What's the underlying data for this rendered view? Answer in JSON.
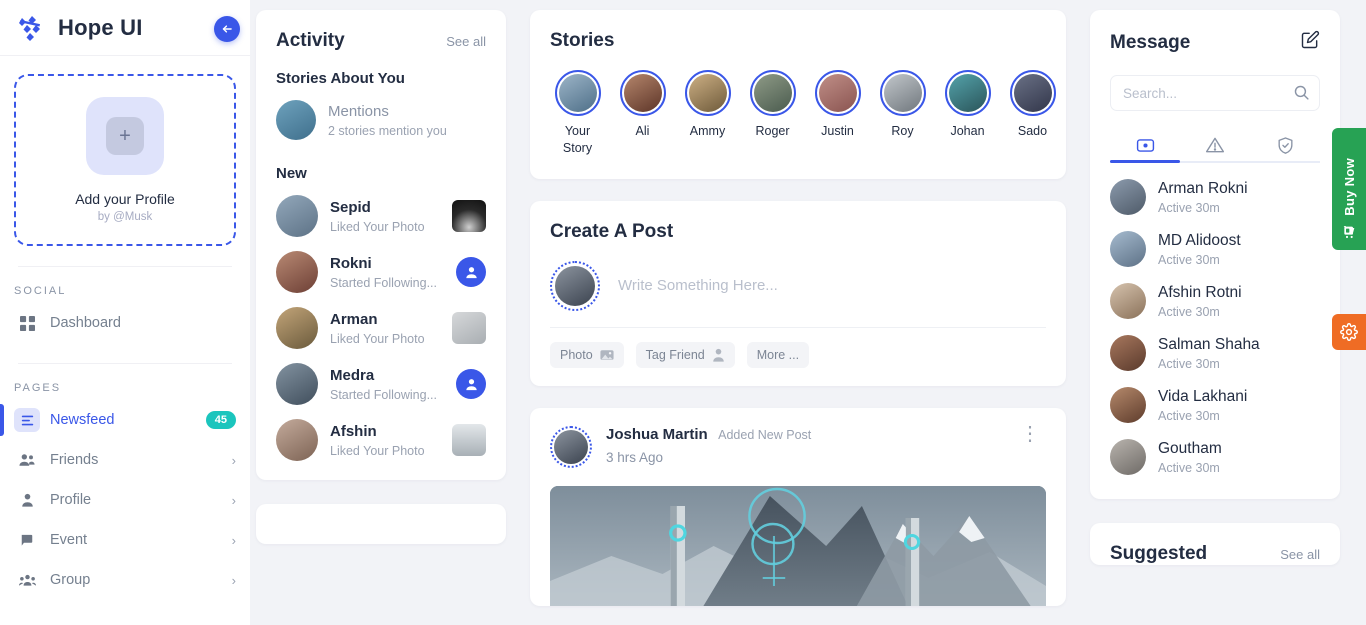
{
  "brand": {
    "title": "Hope UI",
    "logo_icon": "hope-ui-logo"
  },
  "sidebar": {
    "collapse_icon": "arrow-left-icon",
    "profile_card": {
      "plus_icon": "plus-icon",
      "title": "Add your Profile",
      "subtitle": "by @Musk"
    },
    "sections": [
      {
        "label": "SOCIAL",
        "items": [
          {
            "label": "Dashboard",
            "icon": "grid-icon",
            "active": false,
            "badge": null,
            "chevron": false
          }
        ]
      },
      {
        "label": "PAGES",
        "items": [
          {
            "label": "Newsfeed",
            "icon": "feed-icon",
            "active": true,
            "badge": "45",
            "chevron": false
          },
          {
            "label": "Friends",
            "icon": "friends-icon",
            "active": false,
            "badge": null,
            "chevron": true
          },
          {
            "label": "Profile",
            "icon": "person-icon",
            "active": false,
            "badge": null,
            "chevron": true
          },
          {
            "label": "Event",
            "icon": "event-flag-icon",
            "active": false,
            "badge": null,
            "chevron": true
          },
          {
            "label": "Group",
            "icon": "group-icon",
            "active": false,
            "badge": null,
            "chevron": true
          }
        ]
      }
    ]
  },
  "activity": {
    "title": "Activity",
    "see_all": "See all",
    "stories_about_you_heading": "Stories About You",
    "mentions": {
      "name": "Mentions",
      "sub": "2 stories mention you",
      "avatar_color": "#5c8fb0"
    },
    "new_heading": "New",
    "items": [
      {
        "name": "Sepid",
        "sub": "Liked Your Photo",
        "trailing": "thumb",
        "avatar_color": "#7c93a8",
        "thumb_color": "#2a2a2a"
      },
      {
        "name": "Rokni",
        "sub": "Started Following...",
        "trailing": "follow",
        "avatar_color": "#8d5c4e",
        "thumb_color": ""
      },
      {
        "name": "Arman",
        "sub": "Liked Your Photo",
        "trailing": "thumb",
        "avatar_color": "#9c8260",
        "thumb_color": "#b9bcbe"
      },
      {
        "name": "Medra",
        "sub": "Started Following...",
        "trailing": "follow",
        "avatar_color": "#5e6c7a",
        "thumb_color": ""
      },
      {
        "name": "Afshin",
        "sub": "Liked Your Photo",
        "trailing": "thumb",
        "avatar_color": "#a08b7d",
        "thumb_color": "#c2c8cc"
      }
    ],
    "follow_icon": "add-person-icon"
  },
  "stories": {
    "title": "Stories",
    "items": [
      {
        "name": "Your Story",
        "avatar_color": "#6d8aa5"
      },
      {
        "name": "Ali",
        "avatar_color": "#8a5f4c"
      },
      {
        "name": "Ammy",
        "avatar_color": "#a3875f"
      },
      {
        "name": "Roger",
        "avatar_color": "#6f7f6a"
      },
      {
        "name": "Justin",
        "avatar_color": "#b07d78"
      },
      {
        "name": "Roy",
        "avatar_color": "#98a0a6"
      },
      {
        "name": "Johan",
        "avatar_color": "#3f7f86"
      },
      {
        "name": "Sado",
        "avatar_color": "#4a4f63"
      }
    ]
  },
  "create_post": {
    "title": "Create A Post",
    "placeholder": "Write Something Here...",
    "avatar_color": "#4e5866",
    "actions": [
      {
        "label": "Photo",
        "icon": "photo-icon"
      },
      {
        "label": "Tag Friend",
        "icon": "person-icon"
      },
      {
        "label": "More ...",
        "icon": ""
      }
    ]
  },
  "feed_post": {
    "author": "Joshua Martin",
    "action": "Added New Post",
    "time": "3 hrs Ago",
    "menu_icon": "kebab-menu-icon",
    "avatar_color": "#4e5866"
  },
  "message": {
    "title": "Message",
    "compose_icon": "compose-edit-icon",
    "search_placeholder": "Search...",
    "search_value": "",
    "search_icon": "search-icon",
    "tabs": [
      {
        "icon": "chat-bubble-icon",
        "active": true
      },
      {
        "icon": "alert-triangle-icon",
        "active": false
      },
      {
        "icon": "shield-check-icon",
        "active": false
      }
    ],
    "contacts": [
      {
        "name": "Arman Rokni",
        "status": "Active 30m",
        "avatar_color": "#6b7a8c"
      },
      {
        "name": "MD Alidoost",
        "status": "Active 30m",
        "avatar_color": "#8296ad"
      },
      {
        "name": "Afshin Rotni",
        "status": "Active 30m",
        "avatar_color": "#b79d86"
      },
      {
        "name": "Salman Shaha",
        "status": "Active 30m",
        "avatar_color": "#8b6a55"
      },
      {
        "name": "Vida Lakhani",
        "status": "Active 30m",
        "avatar_color": "#9a7158"
      },
      {
        "name": "Goutham",
        "status": "Active 30m",
        "avatar_color": "#9b9791"
      }
    ]
  },
  "suggested": {
    "title": "Suggested",
    "see_all": "See all"
  },
  "floating": {
    "buy_now": {
      "label": "Buy Now",
      "icon": "cart-icon",
      "color": "#27a254"
    },
    "settings": {
      "icon": "gear-icon",
      "color": "#ef6c24"
    }
  },
  "colors": {
    "accent": "#3a57e8",
    "badge": "#1bc5bd",
    "page_bg": "#f2f3f7"
  }
}
